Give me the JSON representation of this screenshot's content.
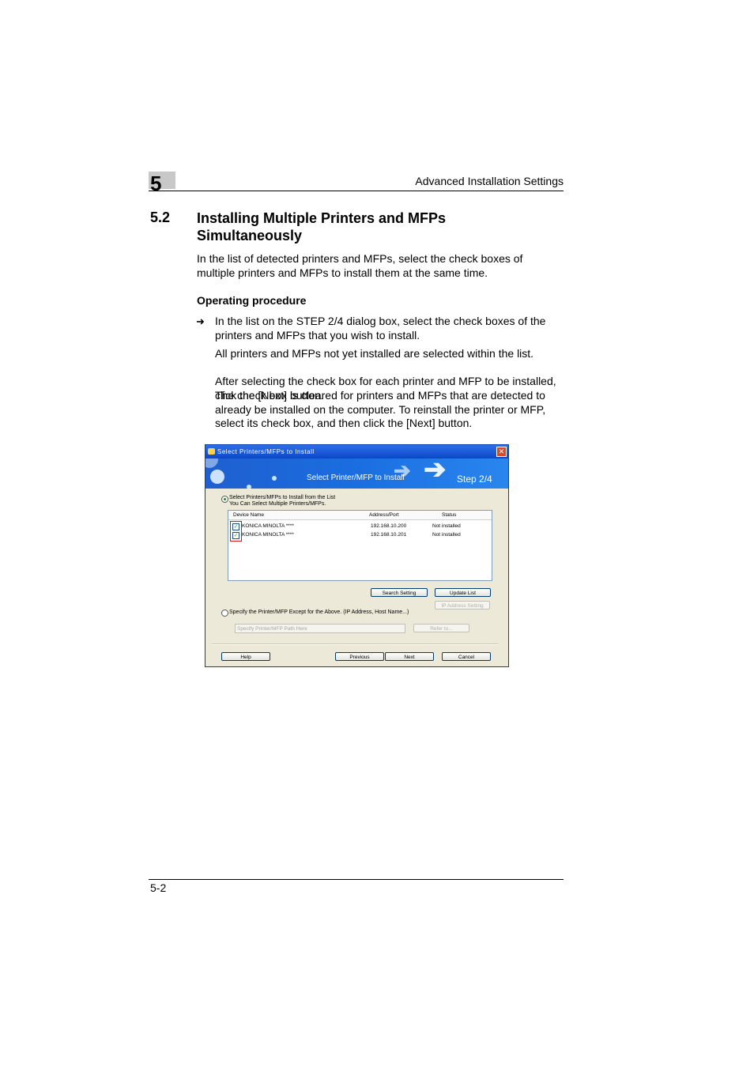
{
  "header": {
    "chapter": "5",
    "title": "Advanced Installation Settings"
  },
  "section": {
    "number": "5.2",
    "title": "Installing Multiple Printers and MFPs Simultaneously"
  },
  "intro": "In the list of detected printers and MFPs, select the check boxes of multiple printers and MFPs to install them at the same time.",
  "procedure_heading": "Operating procedure",
  "step": {
    "arrow": "➜",
    "text": "In the list on the STEP 2/4 dialog box, select the check boxes of the printers and MFPs that you wish to install.",
    "notes": [
      "All printers and MFPs not yet installed are selected within the list.",
      "After selecting the check box for each printer and MFP to be installed, click the [Next] button.",
      "The check box is cleared for printers and MFPs that are detected to already be installed on the computer. To reinstall the printer or MFP, select its check box, and then click the [Next] button."
    ]
  },
  "dialog": {
    "title": "Select Printers/MFPs to Install",
    "close": "✕",
    "banner_text": "Select Printer/MFP to Install",
    "banner_step": "Step 2/4",
    "option1_line1": "Select Printers/MFPs to Install from the List",
    "option1_line2": "You Can Select Multiple Printers/MFPs.",
    "columns": [
      "Device Name",
      "Address/Port",
      "Status"
    ],
    "rows": [
      {
        "name": "KONICA MINOLTA ****",
        "address": "192.168.10.200",
        "status": "Not installed",
        "checked": true
      },
      {
        "name": "KONICA MINOLTA ****",
        "address": "192.168.10.201",
        "status": "Not installed",
        "checked": true
      }
    ],
    "search_setting": "Search Setting",
    "update_list": "Update List",
    "option2": "Specify the Printer/MFP Except for the Above. (IP Address, Host Name...)",
    "ip_address_setting": "IP Address Setting",
    "path_placeholder": "Specify Printer/MFP Path Here",
    "refer_to": "Refer to...",
    "help": "Help",
    "previous": "Previous",
    "next": "Next",
    "cancel": "Cancel"
  },
  "footer": {
    "page": "5-2"
  }
}
